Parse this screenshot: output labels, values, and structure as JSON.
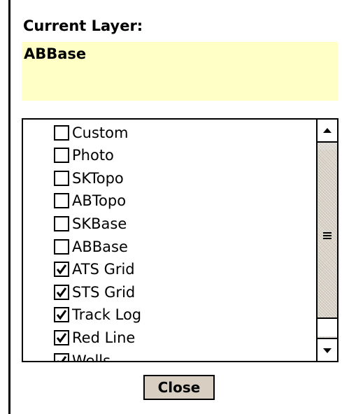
{
  "current_layer": {
    "label": "Current Layer:",
    "value": "ABBase"
  },
  "layers": {
    "items": [
      {
        "label": "Custom",
        "checked": false
      },
      {
        "label": "Photo",
        "checked": false
      },
      {
        "label": "SKTopo",
        "checked": false
      },
      {
        "label": "ABTopo",
        "checked": false
      },
      {
        "label": "SKBase",
        "checked": false
      },
      {
        "label": "ABBase",
        "checked": false
      },
      {
        "label": "ATS Grid",
        "checked": true
      },
      {
        "label": "STS Grid",
        "checked": true
      },
      {
        "label": "Track Log",
        "checked": true
      },
      {
        "label": "Red Line",
        "checked": true
      },
      {
        "label": "Wells",
        "checked": true
      }
    ]
  },
  "buttons": {
    "close_label": "Close"
  },
  "icons": {
    "scroll_up": "scroll-up-arrow-icon",
    "scroll_down": "scroll-down-arrow-icon",
    "grip": "scroll-grip-icon",
    "check": "checkmark-icon"
  },
  "colors": {
    "current_layer_bg": "#ffffc6",
    "button_bg": "#d8cfc2"
  }
}
